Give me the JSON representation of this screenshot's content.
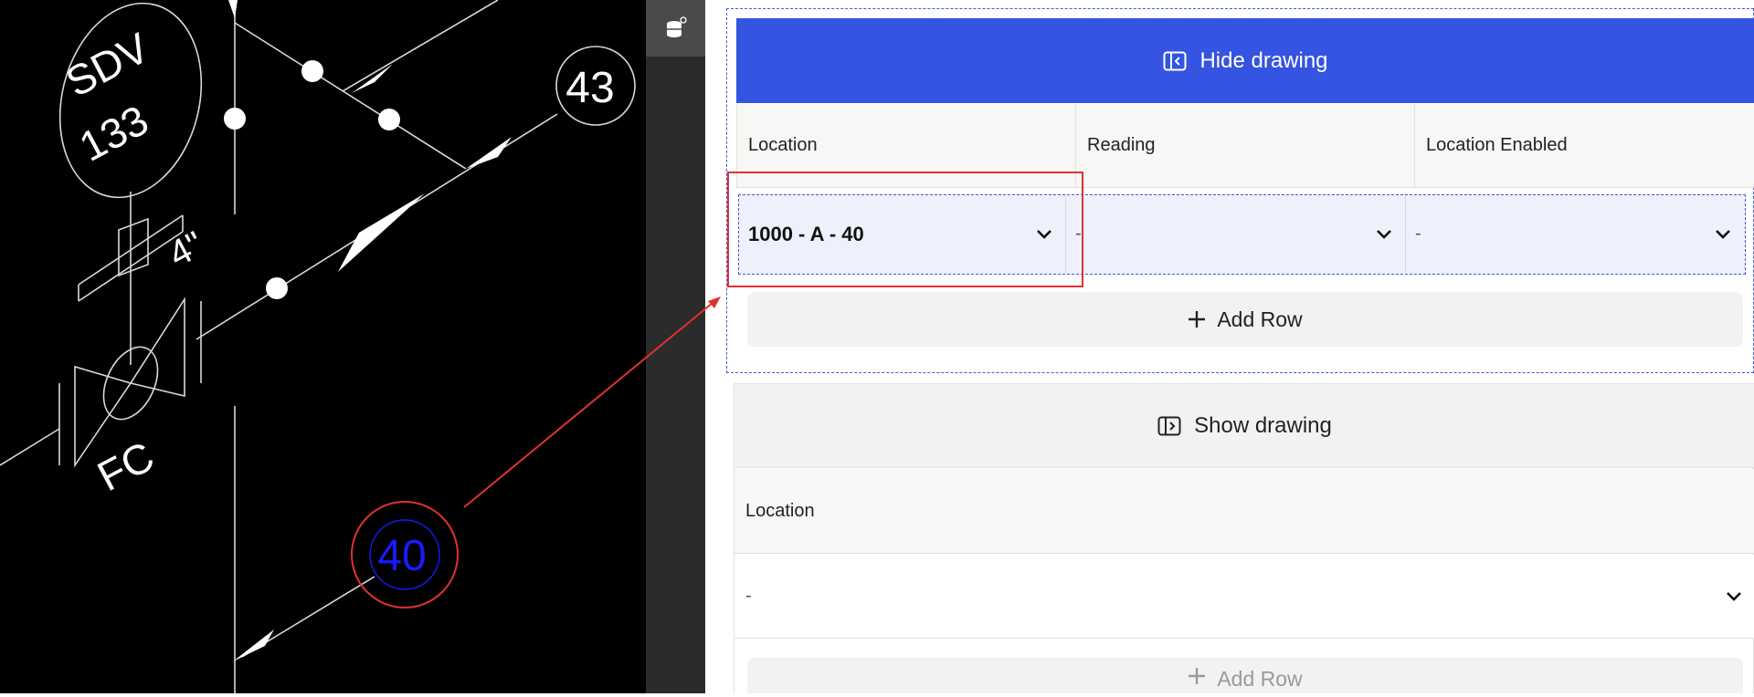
{
  "drawing": {
    "labels": {
      "sdv_tag": "SDV",
      "sdv_number": "133",
      "size": "4\"",
      "valve_mode": "FC",
      "bubble_43": "43",
      "bubble_40": "40"
    },
    "toolbar_icon": "cylinder-stack-icon"
  },
  "panel_1": {
    "hide_button_label": "Hide drawing",
    "hide_icon": "panel-collapse-icon",
    "headers": [
      "Location",
      "Reading",
      "Location Enabled"
    ],
    "row": {
      "location": "1000 - A - 40",
      "reading": "-",
      "location_enabled": "-"
    },
    "add_row_label": "Add Row"
  },
  "panel_2": {
    "show_button_label": "Show drawing",
    "show_icon": "panel-expand-icon",
    "header": "Location",
    "row": {
      "location": "-"
    },
    "add_row_label": "Add Row"
  },
  "colors": {
    "primary": "#3454e1",
    "highlight": "#e03131",
    "dashed_selection": "#3b5bdb",
    "drawing_bg": "#000000",
    "drawing_line": "#d9d9d9",
    "bubble_text": "#1a1aff"
  }
}
